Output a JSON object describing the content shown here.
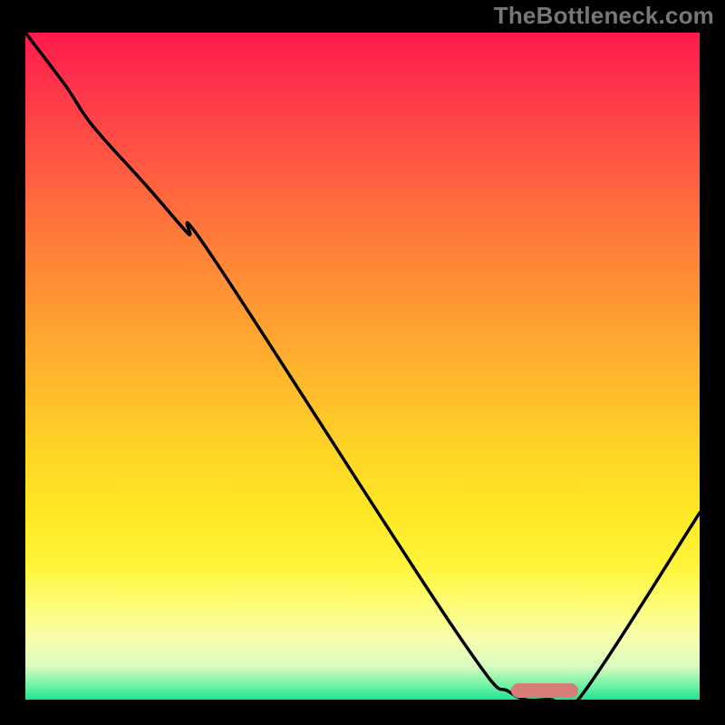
{
  "attribution": "TheBottleneck.com",
  "colors": {
    "frame_bg": "#000000",
    "attribution_text": "#777777",
    "curve": "#000000",
    "marker": "#d77d78",
    "gradient_top": "#ff1a4d",
    "gradient_bottom": "#1fe493"
  },
  "chart_data": {
    "type": "line",
    "title": "",
    "xlabel": "",
    "ylabel": "",
    "xlim": [
      0,
      100
    ],
    "ylim": [
      0,
      100
    ],
    "grid": false,
    "legend": false,
    "x": [
      0,
      6,
      10,
      18,
      24,
      28,
      64,
      72,
      78,
      82,
      100
    ],
    "values": [
      100,
      92,
      86,
      77,
      70,
      66,
      10,
      1,
      0,
      0,
      28
    ],
    "marker": {
      "x_start": 72,
      "x_end": 82,
      "y": 0
    },
    "annotations": []
  }
}
